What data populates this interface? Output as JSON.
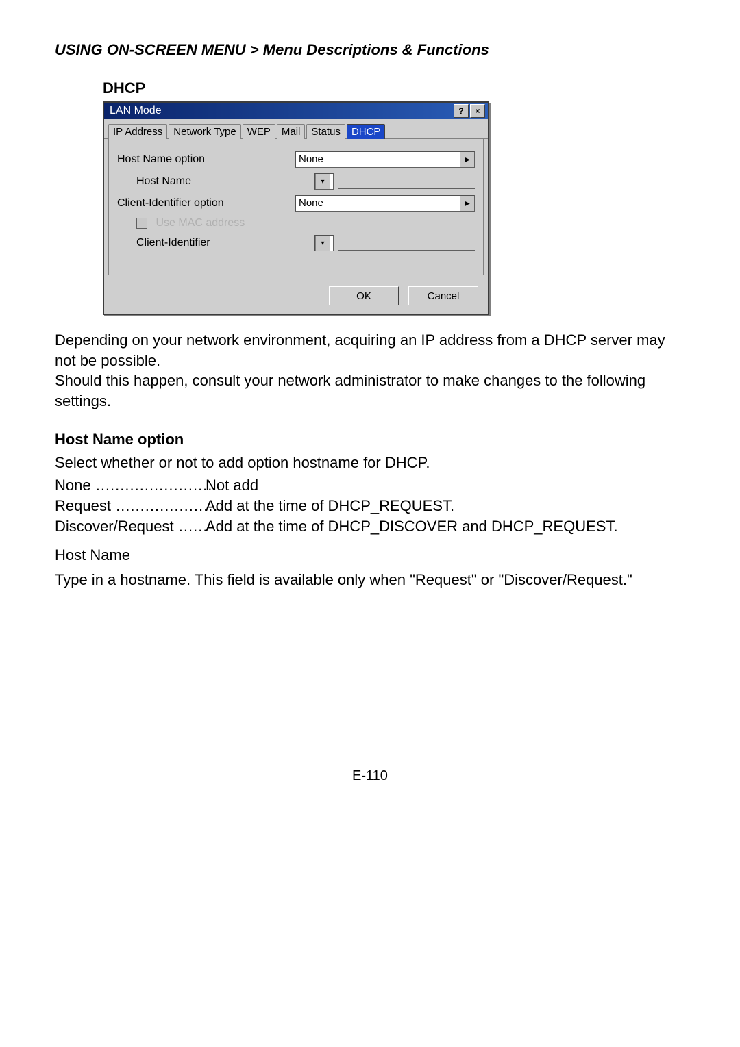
{
  "breadcrumb": "USING ON-SCREEN MENU > Menu Descriptions & Functions",
  "section_title": "DHCP",
  "dialog": {
    "title": "LAN Mode",
    "help_icon": "?",
    "close_icon": "×",
    "tabs": [
      "IP Address",
      "Network Type",
      "WEP",
      "Mail",
      "Status",
      "DHCP"
    ],
    "active_tab": "DHCP",
    "rows": {
      "host_name_option_label": "Host Name option",
      "host_name_option_value": "None",
      "host_name_label": "Host Name",
      "client_identifier_option_label": "Client-Identifier option",
      "client_identifier_option_value": "None",
      "use_mac_label": "Use MAC address",
      "client_identifier_label": "Client-Identifier"
    },
    "ok": "OK",
    "cancel": "Cancel"
  },
  "paras": {
    "p1a": "Depending on your network environment, acquiring an IP address from a DHCP server may not be possible.",
    "p1b": "Should this happen, consult your network administrator to make changes to the following settings."
  },
  "host_name_option": {
    "heading": "Host Name option",
    "lead": "Select whether or not to add option hostname for DHCP.",
    "none_term": "None",
    "none_dots": " ........................ ",
    "none_val": "Not add",
    "request_term": "Request",
    "request_dots": " ..................... ",
    "request_val": "Add at the time of DHCP_REQUEST.",
    "dr_term": "Discover/Request",
    "dr_dots": " ...... ",
    "dr_val": "Add at the time of DHCP_DISCOVER and DHCP_REQUEST.",
    "hostname_label": "Host Name",
    "hostname_desc": "Type in a hostname. This field is available only when \"Request\" or \"Discover/Request.\""
  },
  "page_number": "E-110"
}
